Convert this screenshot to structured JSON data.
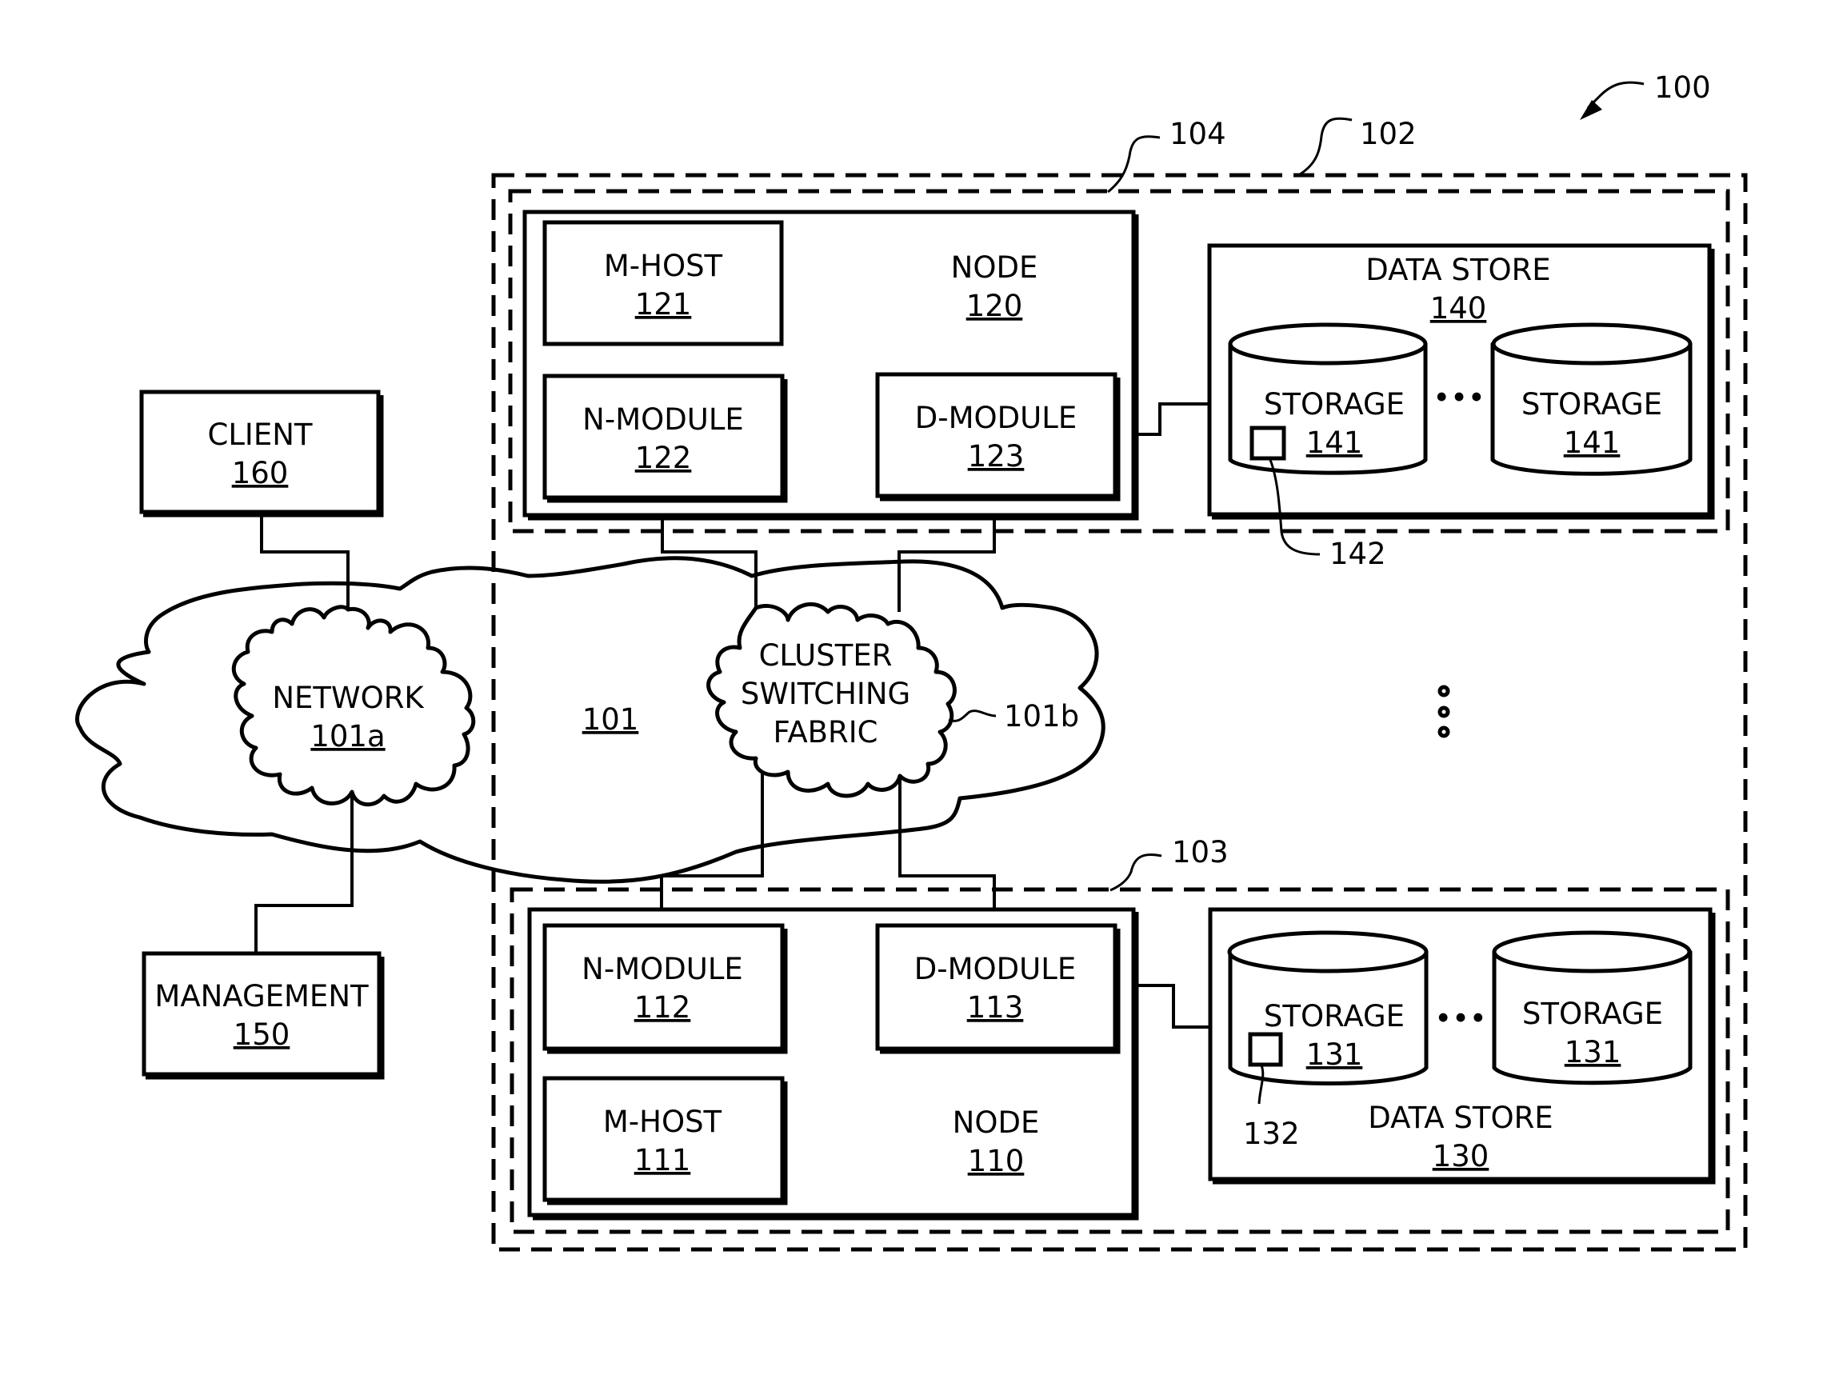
{
  "figure": {
    "ref": "100",
    "containers": {
      "cluster": {
        "ref": "102"
      },
      "upper_group": {
        "ref": "104"
      },
      "lower_group": {
        "ref": "103"
      }
    },
    "client": {
      "label": "CLIENT",
      "ref": "160"
    },
    "management": {
      "label": "MANAGEMENT",
      "ref": "150"
    },
    "interconnect": {
      "ref": "101"
    },
    "network": {
      "label": "NETWORK",
      "ref": "101a"
    },
    "fabric": {
      "lines": [
        "CLUSTER",
        "SWITCHING",
        "FABRIC"
      ],
      "ref": "101b"
    },
    "node_upper": {
      "label": "NODE",
      "ref": "120",
      "mhost": {
        "label": "M-HOST",
        "ref": "121"
      },
      "nmodule": {
        "label": "N-MODULE",
        "ref": "122"
      },
      "dmodule": {
        "label": "D-MODULE",
        "ref": "123"
      }
    },
    "datastore_upper": {
      "label": "DATA STORE",
      "ref": "140",
      "storage_a": {
        "label": "STORAGE",
        "ref": "141"
      },
      "storage_b": {
        "label": "STORAGE",
        "ref": "141"
      },
      "element_ref": "142",
      "ellipsis": "•••"
    },
    "node_lower": {
      "label": "NODE",
      "ref": "110",
      "mhost": {
        "label": "M-HOST",
        "ref": "111"
      },
      "nmodule": {
        "label": "N-MODULE",
        "ref": "112"
      },
      "dmodule": {
        "label": "D-MODULE",
        "ref": "113"
      }
    },
    "datastore_lower": {
      "label": "DATA STORE",
      "ref": "130",
      "storage_a": {
        "label": "STORAGE",
        "ref": "131"
      },
      "storage_b": {
        "label": "STORAGE",
        "ref": "131"
      },
      "element_ref": "132",
      "ellipsis": "•••"
    }
  }
}
